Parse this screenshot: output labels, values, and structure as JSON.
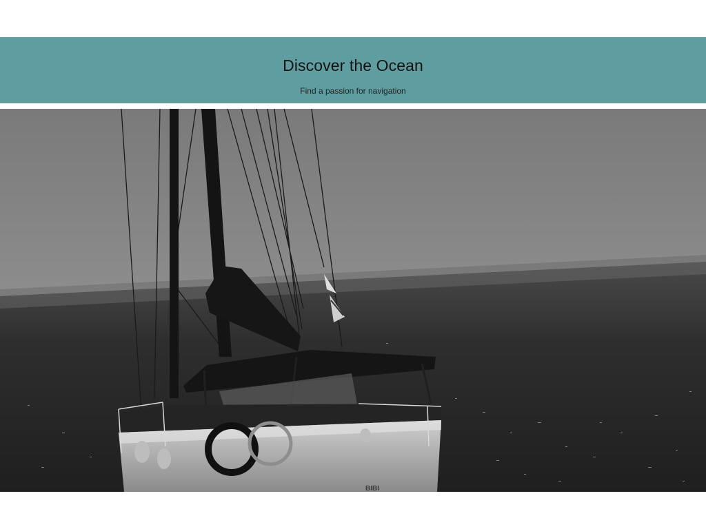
{
  "hero": {
    "title": "Discover the Ocean",
    "subtitle": "Find a passion for navigation",
    "background_color": "#5f9ea0"
  },
  "image": {
    "subject": "sailboat-on-ocean",
    "boat_name": "BIBI",
    "style": "black-and-white"
  }
}
